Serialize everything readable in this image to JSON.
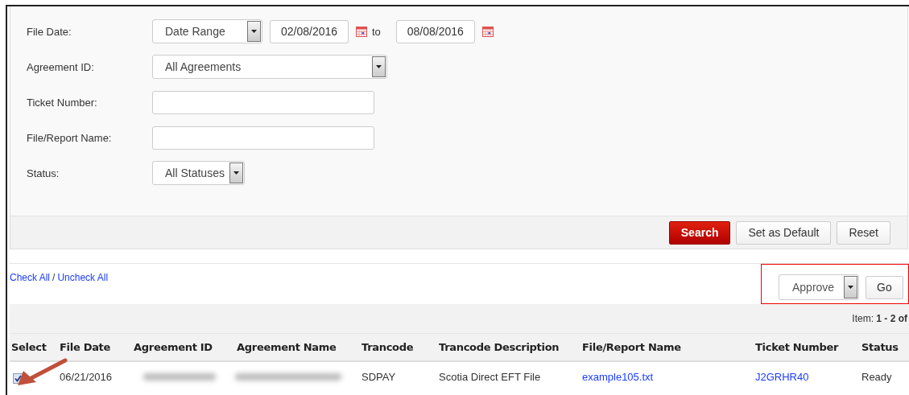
{
  "filters": [
    {
      "label": "File Date:",
      "kind": "date_range",
      "select": "Date Range",
      "from": "02/08/2016",
      "connector": "to",
      "to": "08/08/2016"
    },
    {
      "label": "Agreement ID:",
      "kind": "select",
      "value": "All Agreements"
    },
    {
      "label": "Ticket Number:",
      "kind": "text"
    },
    {
      "label": "File/Report Name:",
      "kind": "text"
    },
    {
      "label": "Status:",
      "kind": "select",
      "value": "All Statuses"
    }
  ],
  "actions": [
    {
      "label": "Search",
      "kind": "primary"
    },
    {
      "label": "Set as Default",
      "kind": "secondary"
    },
    {
      "label": "Reset",
      "kind": "secondary"
    }
  ],
  "bulk": {
    "check_all": "Check All",
    "separator": "/",
    "uncheck_all": "Uncheck All",
    "action": "Approve",
    "go": "Go",
    "highlighted": true
  },
  "pagination": "Item: **1 - 2 of**",
  "table": {
    "columns": [
      "Select",
      "File Date",
      "Agreement ID",
      "Agreement Name",
      "Trancode",
      "Trancode Description",
      "File/Report Name",
      "Ticket Number",
      "Status"
    ],
    "rows": [
      {
        "cells": [
          {
            "kind": "checkbox",
            "selected": true
          },
          {
            "kind": "text",
            "text": "06/21/2016"
          },
          {
            "kind": "blurred"
          },
          {
            "kind": "blurred"
          },
          {
            "kind": "text",
            "text": "SDPAY"
          },
          {
            "kind": "text",
            "text": "Scotia Direct EFT File"
          },
          {
            "kind": "link",
            "text": "example105.txt"
          },
          {
            "kind": "link",
            "text": "J2GRHR40"
          },
          {
            "kind": "text",
            "text": "Ready"
          }
        ]
      }
    ]
  },
  "arrow_annotation": true
}
